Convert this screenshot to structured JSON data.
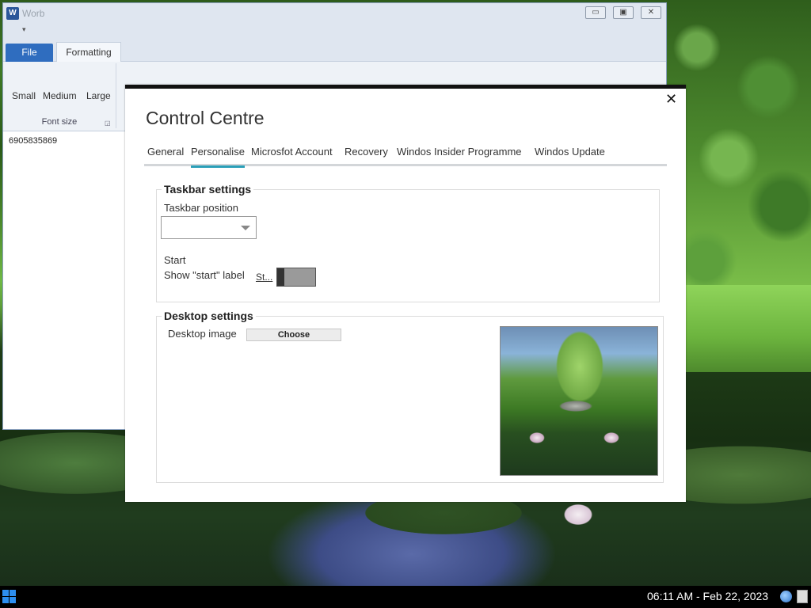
{
  "word": {
    "app_icon": "W",
    "title": "Worb",
    "controls": {
      "minimize_icon": "minimize-icon",
      "maximize_icon": "maximize-icon",
      "close_icon": "close-icon"
    },
    "qat_arrow": "▾",
    "tabs": {
      "file": "File",
      "formatting": "Formatting"
    },
    "font_size_buttons": [
      "Small",
      "Medium",
      "Large"
    ],
    "font_size_group_label": "Font size",
    "document_text": "6905835869"
  },
  "control_centre": {
    "close_glyph": "✕",
    "title": "Control Centre",
    "tabs": [
      "General",
      "Personalise",
      "Microsfot Account",
      "Recovery",
      "Windos Insider Programme",
      "Windos Update"
    ],
    "active_tab": "Personalise",
    "taskbar_settings": {
      "title": "Taskbar settings",
      "position_label": "Taskbar position",
      "position_value": "",
      "start_label": "Start",
      "show_start_label": "Show \"start\" label",
      "toggle_text": "St...",
      "toggle_on": false
    },
    "desktop_settings": {
      "title": "Desktop settings",
      "image_label": "Desktop image",
      "choose_label": "Choose"
    }
  },
  "taskbar": {
    "clock": "06:11 AM - Feb 22, 2023",
    "accent_color": "#2d8ff0"
  }
}
